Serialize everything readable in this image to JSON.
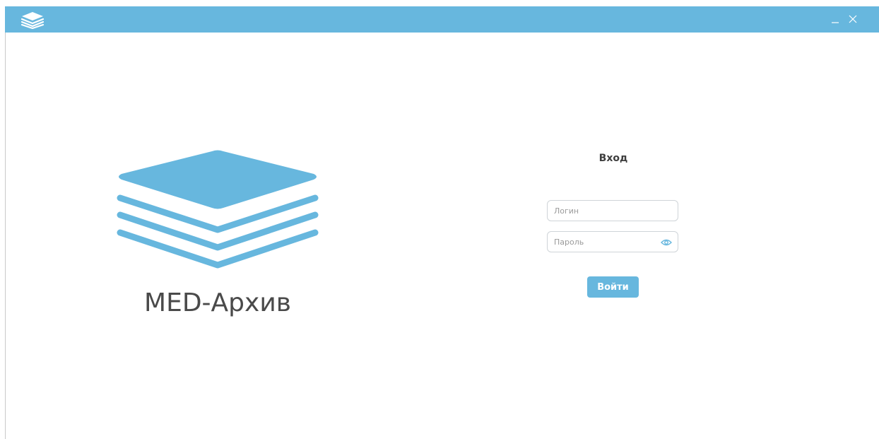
{
  "window": {
    "minimize_symbol": "_",
    "close_symbol": "✕",
    "accent_color": "#67b7de"
  },
  "icons": {
    "app": "layers-stack-icon",
    "logo": "layers-stack-icon",
    "password_toggle": "eye-icon"
  },
  "brand": {
    "name": "MED-Архив"
  },
  "login": {
    "title": "Вход",
    "login_placeholder": "Логин",
    "login_value": "",
    "password_placeholder": "Пароль",
    "password_value": "",
    "submit_label": "Войти"
  }
}
